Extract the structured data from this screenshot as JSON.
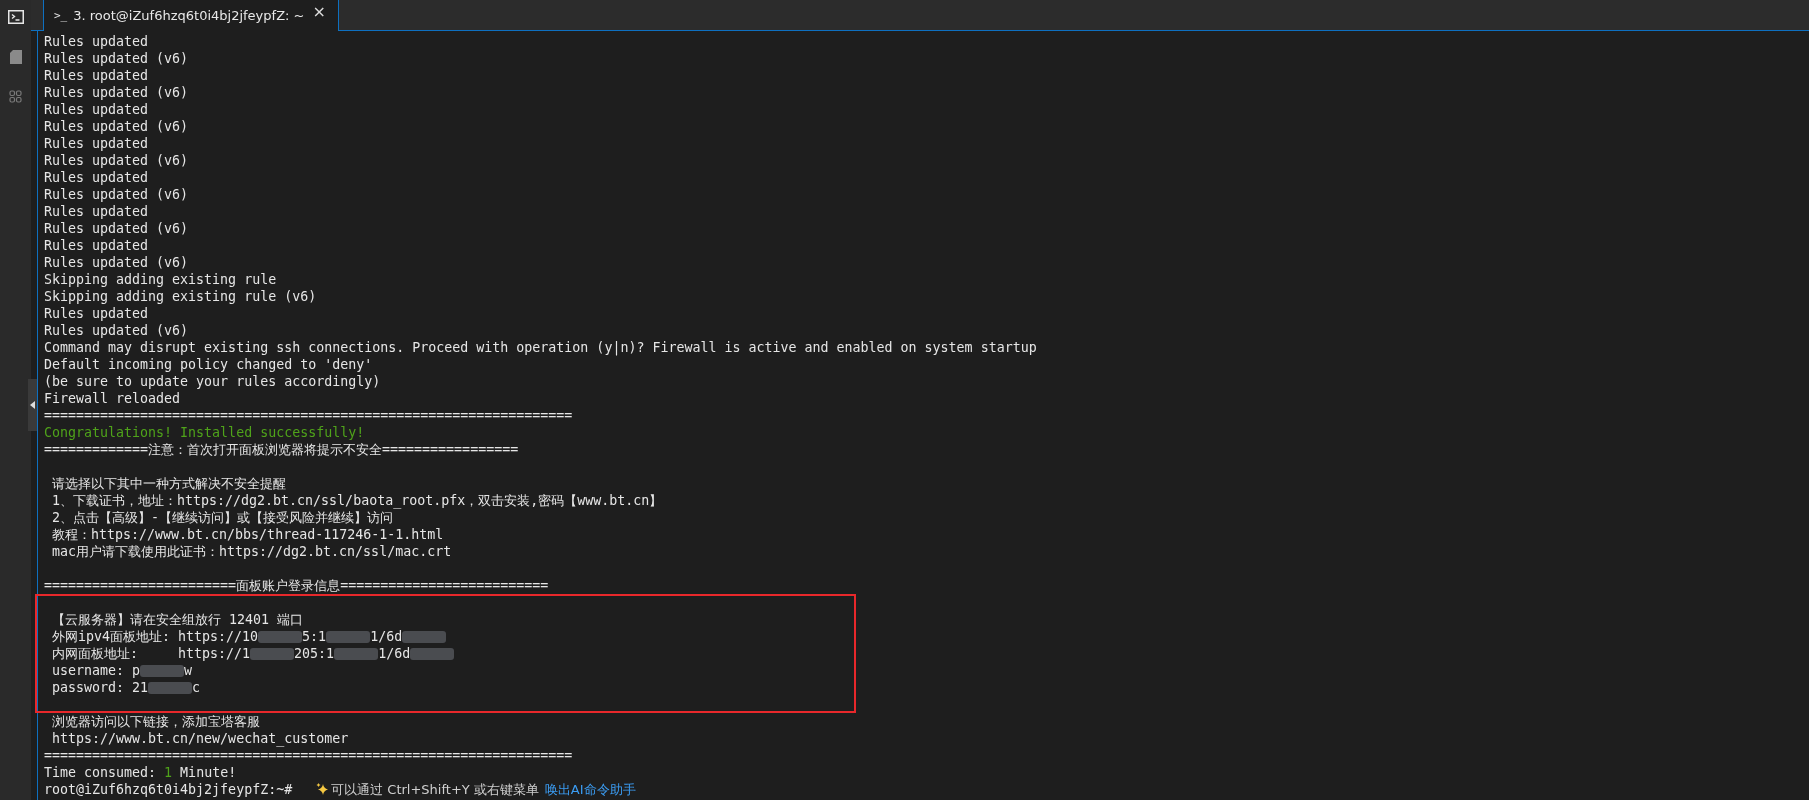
{
  "tab": {
    "title": "3. root@iZuf6hzq6t0i4bj2jfeypfZ: ~",
    "prompt_glyph": ">_",
    "close_glyph": "×"
  },
  "terminal": {
    "lines_before": [
      {
        "kind": "text",
        "text": "Rules updated"
      },
      {
        "kind": "text",
        "text": "Rules updated (v6)"
      },
      {
        "kind": "text",
        "text": "Rules updated"
      },
      {
        "kind": "text",
        "text": "Rules updated (v6)"
      },
      {
        "kind": "text",
        "text": "Rules updated"
      },
      {
        "kind": "text",
        "text": "Rules updated (v6)"
      },
      {
        "kind": "text",
        "text": "Rules updated"
      },
      {
        "kind": "text",
        "text": "Rules updated (v6)"
      },
      {
        "kind": "text",
        "text": "Rules updated"
      },
      {
        "kind": "text",
        "text": "Rules updated (v6)"
      },
      {
        "kind": "text",
        "text": "Rules updated"
      },
      {
        "kind": "text",
        "text": "Rules updated (v6)"
      },
      {
        "kind": "text",
        "text": "Rules updated"
      },
      {
        "kind": "text",
        "text": "Rules updated (v6)"
      },
      {
        "kind": "text",
        "text": "Skipping adding existing rule"
      },
      {
        "kind": "text",
        "text": "Skipping adding existing rule (v6)"
      },
      {
        "kind": "text",
        "text": "Rules updated"
      },
      {
        "kind": "text",
        "text": "Rules updated (v6)"
      },
      {
        "kind": "text",
        "text": "Command may disrupt existing ssh connections. Proceed with operation (y|n)? Firewall is active and enabled on system startup"
      },
      {
        "kind": "text",
        "text": "Default incoming policy changed to 'deny'"
      },
      {
        "kind": "text",
        "text": "(be sure to update your rules accordingly)"
      },
      {
        "kind": "text",
        "text": "Firewall reloaded"
      },
      {
        "kind": "text",
        "text": "=================================================================="
      },
      {
        "kind": "success",
        "text": "Congratulations! Installed successfully!"
      },
      {
        "kind": "text",
        "text": "=============注意：首次打开面板浏览器将提示不安全================="
      },
      {
        "kind": "blank"
      },
      {
        "kind": "text",
        "text": " 请选择以下其中一种方式解决不安全提醒"
      },
      {
        "kind": "text",
        "text": " 1、下载证书，地址：https://dg2.bt.cn/ssl/baota_root.pfx，双击安装,密码【www.bt.cn】"
      },
      {
        "kind": "text",
        "text": " 2、点击【高级】-【继续访问】或【接受风险并继续】访问"
      },
      {
        "kind": "text",
        "text": " 教程：https://www.bt.cn/bbs/thread-117246-1-1.html"
      },
      {
        "kind": "text",
        "text": " mac用户请下载使用此证书：https://dg2.bt.cn/ssl/mac.crt"
      },
      {
        "kind": "blank"
      },
      {
        "kind": "text",
        "text": "========================面板账户登录信息=========================="
      }
    ],
    "highlighted_lines": [
      {
        "kind": "blank"
      },
      {
        "kind": "text",
        "text": " 【云服务器】请在安全组放行 12401 端口"
      },
      {
        "kind": "redacted",
        "parts": [
          {
            "kind": "text",
            "text": " 外网ipv4面板地址: https://10"
          },
          {
            "kind": "blur"
          },
          {
            "kind": "text",
            "text": "5:1"
          },
          {
            "kind": "blur"
          },
          {
            "kind": "text",
            "text": "1/6d"
          },
          {
            "kind": "blur"
          }
        ]
      },
      {
        "kind": "redacted",
        "parts": [
          {
            "kind": "text",
            "text": " 内网面板地址:     https://1"
          },
          {
            "kind": "blur"
          },
          {
            "kind": "text",
            "text": "205:1"
          },
          {
            "kind": "blur"
          },
          {
            "kind": "text",
            "text": "1/6d"
          },
          {
            "kind": "blur"
          }
        ]
      },
      {
        "kind": "redacted",
        "parts": [
          {
            "kind": "text",
            "text": " username: p"
          },
          {
            "kind": "blur"
          },
          {
            "kind": "text",
            "text": "w"
          }
        ]
      },
      {
        "kind": "redacted",
        "parts": [
          {
            "kind": "text",
            "text": " password: 21"
          },
          {
            "kind": "blur"
          },
          {
            "kind": "text",
            "text": "c"
          }
        ]
      },
      {
        "kind": "blank"
      }
    ],
    "lines_after": [
      {
        "kind": "text",
        "text": " 浏览器访问以下链接，添加宝塔客服"
      },
      {
        "kind": "text",
        "text": " https://www.bt.cn/new/wechat_customer"
      },
      {
        "kind": "text",
        "text": "=================================================================="
      },
      {
        "kind": "mixed",
        "parts": [
          {
            "text": "Time consumed: ",
            "accent": false
          },
          {
            "text": "1",
            "accent": true
          },
          {
            "text": " Minute!",
            "accent": false
          }
        ]
      },
      {
        "kind": "prompt",
        "text": "root@iZuf6hzq6t0i4bj2jfeypfZ:~#",
        "hint": "可以通过 Ctrl+Shift+Y 或右键菜单",
        "hint_link": "唤出AI命令助手"
      }
    ]
  }
}
